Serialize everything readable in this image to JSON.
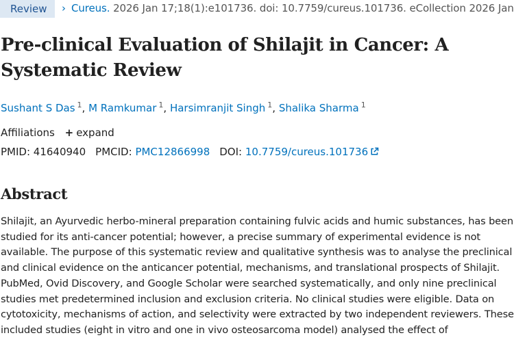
{
  "citation": {
    "type_label": "Review",
    "chevron": "›",
    "journal": "Cureus.",
    "details": " 2026 Jan 17;18(1):e101736. doi: 10.7759/cureus.101736. eCollection 2026 Jan."
  },
  "article": {
    "title": "Pre-clinical Evaluation of Shilajit in Cancer: A Systematic Review"
  },
  "authors": [
    {
      "name": "Sushant S Das",
      "aff": "1"
    },
    {
      "name": "M Ramkumar",
      "aff": "1"
    },
    {
      "name": "Harsimranjit Singh",
      "aff": "1"
    },
    {
      "name": "Shalika Sharma",
      "aff": "1"
    }
  ],
  "affiliations": {
    "label": "Affiliations",
    "expand_label": "expand"
  },
  "identifiers": {
    "pmid_label": "PMID:",
    "pmid": "41640940",
    "pmcid_label": "PMCID:",
    "pmcid": "PMC12866998",
    "doi_label": "DOI:",
    "doi": "10.7759/cureus.101736"
  },
  "abstract": {
    "heading": "Abstract",
    "text": "Shilajit, an Ayurvedic herbo-mineral preparation containing fulvic acids and humic substances, has been studied for its anti-cancer potential; however, a precise summary of experimental evidence is not available. The purpose of this systematic review and qualitative synthesis was to analyse the preclinical and clinical evidence on the anticancer potential, mechanisms, and translational prospects of Shilajit. PubMed, Ovid Discovery, and Google Scholar were searched systematically, and only nine preclinical studies met predetermined inclusion and exclusion criteria. No clinical studies were eligible. Data on cytotoxicity, mechanisms of action, and selectivity were extracted by two independent reviewers. These included studies (eight in vitro and one in vivo osteosarcoma model) analysed the effect of"
  },
  "colors": {
    "link": "#0071bc",
    "badge_bg": "#dde8f3",
    "text": "#212121"
  },
  "icons": {
    "external_link": "external-link-icon",
    "expand": "plus-icon",
    "breadcrumb": "chevron-right-icon"
  }
}
